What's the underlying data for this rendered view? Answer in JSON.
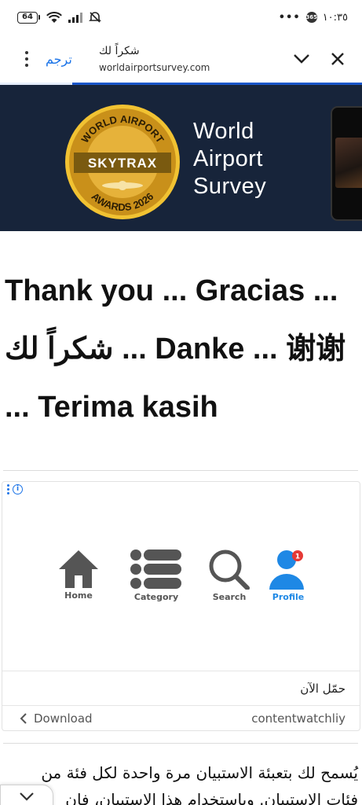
{
  "status_bar": {
    "battery": "64",
    "right_time": "١٠:٣٥",
    "badge": "365"
  },
  "toolbar": {
    "translate_label": "ترجم",
    "tab_title": "شكراً لك",
    "url": "worldairportsurvey.com"
  },
  "hero": {
    "medal_top_text": "WORLD AIRPORT",
    "medal_brand": "SKYTRAX",
    "medal_bottom_text": "AWARDS 2026",
    "survey_line1": "World",
    "survey_line2": "Airport",
    "survey_line3": "Survey"
  },
  "heading": {
    "line1": "Thank you ... Gracias ...",
    "line2_arabic": "شكراً لك",
    "line2_rest": " ... Danke ... 谢谢",
    "line3": "... Terima kasih"
  },
  "ad": {
    "nav_items": [
      {
        "label": "Home"
      },
      {
        "label": "Category"
      },
      {
        "label": "Search"
      },
      {
        "label": "Profile",
        "badge": "1"
      }
    ],
    "cta": "حمّل الآن",
    "download_label": "Download",
    "advertiser": "contentwatchliy",
    "accent_color": "#1e88e5"
  },
  "body_text": {
    "line1": "يُسمح لك بتعبئة الاستبيان مرة واحدة لكل فئة من",
    "line2": "فئات الاستبيان. وباستخدام هذا الاستبيان، فإن"
  },
  "colors": {
    "progress": "#1a56c9",
    "hero_bg": "#17243a",
    "link": "#1a73e8"
  }
}
